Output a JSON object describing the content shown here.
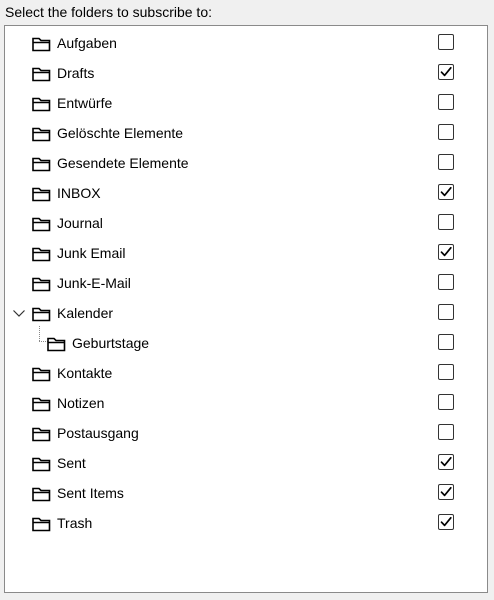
{
  "prompt": "Select the folders to subscribe to:",
  "folders": [
    {
      "name": "Aufgaben",
      "checked": false
    },
    {
      "name": "Drafts",
      "checked": true
    },
    {
      "name": "Entwürfe",
      "checked": false
    },
    {
      "name": "Gelöschte Elemente",
      "checked": false
    },
    {
      "name": "Gesendete Elemente",
      "checked": false
    },
    {
      "name": "INBOX",
      "checked": true
    },
    {
      "name": "Journal",
      "checked": false
    },
    {
      "name": "Junk Email",
      "checked": true
    },
    {
      "name": "Junk-E-Mail",
      "checked": false
    },
    {
      "name": "Kalender",
      "checked": false,
      "expanded": true,
      "children": [
        {
          "name": "Geburtstage",
          "checked": false
        }
      ]
    },
    {
      "name": "Kontakte",
      "checked": false
    },
    {
      "name": "Notizen",
      "checked": false
    },
    {
      "name": "Postausgang",
      "checked": false
    },
    {
      "name": "Sent",
      "checked": true
    },
    {
      "name": "Sent Items",
      "checked": true
    },
    {
      "name": "Trash",
      "checked": true
    }
  ],
  "icons": {
    "folder": "folder-icon",
    "expander": "chevron-down-icon",
    "check": "checkmark-icon"
  }
}
